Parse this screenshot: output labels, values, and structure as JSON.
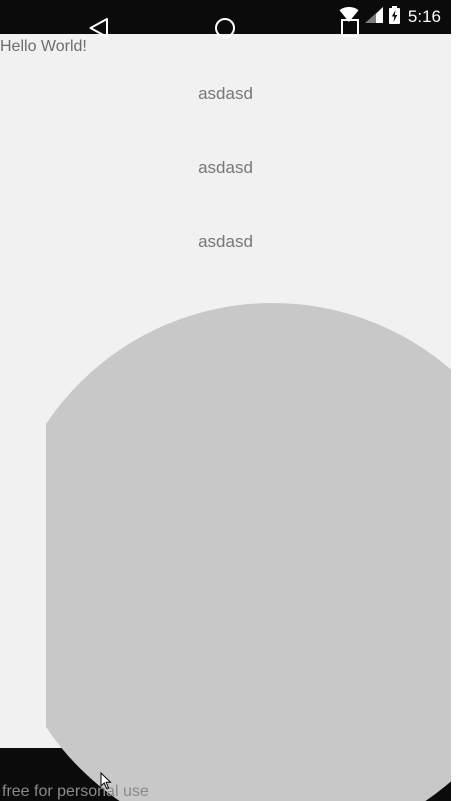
{
  "status_bar": {
    "time": "5:16",
    "icons": [
      "wifi-icon",
      "signal-icon",
      "battery-charging-icon"
    ]
  },
  "main": {
    "hello_text": "Hello World!",
    "items": [
      "asdasd",
      "asdasd",
      "asdasd"
    ]
  },
  "nav_bar": {
    "icons": [
      "back-icon",
      "home-icon",
      "recents-icon"
    ]
  },
  "watermark": "free for personal use",
  "colors": {
    "background": "#f1f1f1",
    "circle": "#c8c8c8",
    "system_bars": "#0b0b0b",
    "text": "#777777"
  }
}
